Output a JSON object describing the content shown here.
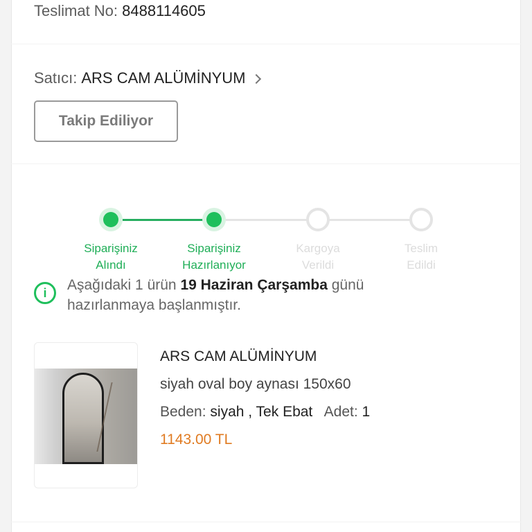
{
  "delivery": {
    "label": "Teslimat No:",
    "number": "8488114605"
  },
  "seller": {
    "label": "Satıcı:",
    "name": "ARS CAM ALÜMİNYUM",
    "follow_button": "Takip Ediliyor"
  },
  "stepper": {
    "steps": [
      {
        "line1": "Siparişiniz",
        "line2": "Alındı",
        "status": "done"
      },
      {
        "line1": "Siparişiniz",
        "line2": "Hazırlanıyor",
        "status": "done"
      },
      {
        "line1": "Kargoya",
        "line2": "Verildi",
        "status": "pending"
      },
      {
        "line1": "Teslim",
        "line2": "Edildi",
        "status": "pending"
      }
    ]
  },
  "info": {
    "icon": "info-icon",
    "prefix": "Aşağıdaki 1 ürün",
    "date": "19 Haziran Çarşamba",
    "suffix": "günü",
    "line2": "hazırlanmaya başlanmıştır."
  },
  "product": {
    "brand": "ARS CAM ALÜMİNYUM",
    "description": "siyah oval boy aynası 150x60",
    "size_label": "Beden:",
    "size_value": "siyah , Tek Ebat",
    "qty_label": "Adet:",
    "qty_value": "1",
    "price": "1143.00 TL"
  },
  "colors": {
    "accent_green": "#1fbf5c",
    "price_orange": "#e07b22"
  }
}
